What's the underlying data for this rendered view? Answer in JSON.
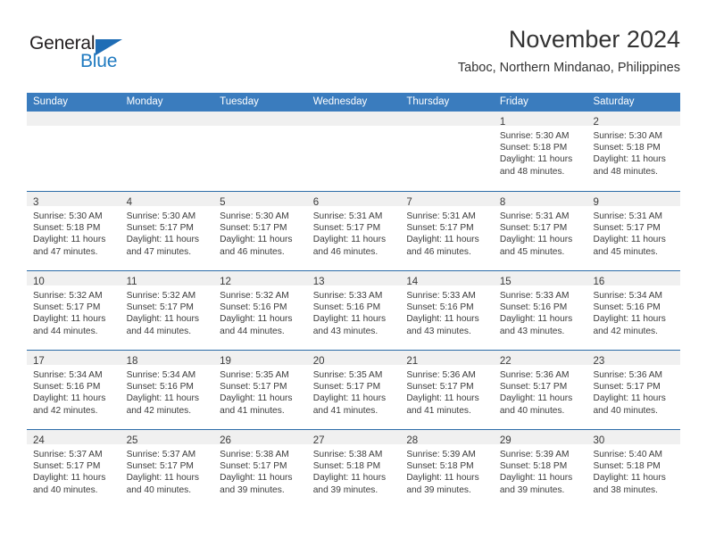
{
  "branding": {
    "logo_text_1": "General",
    "logo_text_2": "Blue"
  },
  "header": {
    "title": "November 2024",
    "subtitle": "Taboc, Northern Mindanao, Philippines"
  },
  "colors": {
    "header_blue": "#3a7cbe",
    "row_divider_blue": "#2c6ca8",
    "day_band_grey": "#f0f0f0",
    "logo_blue": "#1f7ac0",
    "text": "#3b3b3b"
  },
  "weekdays": [
    "Sunday",
    "Monday",
    "Tuesday",
    "Wednesday",
    "Thursday",
    "Friday",
    "Saturday"
  ],
  "weeks": [
    [
      {
        "day": "",
        "lines": []
      },
      {
        "day": "",
        "lines": []
      },
      {
        "day": "",
        "lines": []
      },
      {
        "day": "",
        "lines": []
      },
      {
        "day": "",
        "lines": []
      },
      {
        "day": "1",
        "lines": [
          "Sunrise: 5:30 AM",
          "Sunset: 5:18 PM",
          "Daylight: 11 hours",
          "and 48 minutes."
        ]
      },
      {
        "day": "2",
        "lines": [
          "Sunrise: 5:30 AM",
          "Sunset: 5:18 PM",
          "Daylight: 11 hours",
          "and 48 minutes."
        ]
      }
    ],
    [
      {
        "day": "3",
        "lines": [
          "Sunrise: 5:30 AM",
          "Sunset: 5:18 PM",
          "Daylight: 11 hours",
          "and 47 minutes."
        ]
      },
      {
        "day": "4",
        "lines": [
          "Sunrise: 5:30 AM",
          "Sunset: 5:17 PM",
          "Daylight: 11 hours",
          "and 47 minutes."
        ]
      },
      {
        "day": "5",
        "lines": [
          "Sunrise: 5:30 AM",
          "Sunset: 5:17 PM",
          "Daylight: 11 hours",
          "and 46 minutes."
        ]
      },
      {
        "day": "6",
        "lines": [
          "Sunrise: 5:31 AM",
          "Sunset: 5:17 PM",
          "Daylight: 11 hours",
          "and 46 minutes."
        ]
      },
      {
        "day": "7",
        "lines": [
          "Sunrise: 5:31 AM",
          "Sunset: 5:17 PM",
          "Daylight: 11 hours",
          "and 46 minutes."
        ]
      },
      {
        "day": "8",
        "lines": [
          "Sunrise: 5:31 AM",
          "Sunset: 5:17 PM",
          "Daylight: 11 hours",
          "and 45 minutes."
        ]
      },
      {
        "day": "9",
        "lines": [
          "Sunrise: 5:31 AM",
          "Sunset: 5:17 PM",
          "Daylight: 11 hours",
          "and 45 minutes."
        ]
      }
    ],
    [
      {
        "day": "10",
        "lines": [
          "Sunrise: 5:32 AM",
          "Sunset: 5:17 PM",
          "Daylight: 11 hours",
          "and 44 minutes."
        ]
      },
      {
        "day": "11",
        "lines": [
          "Sunrise: 5:32 AM",
          "Sunset: 5:17 PM",
          "Daylight: 11 hours",
          "and 44 minutes."
        ]
      },
      {
        "day": "12",
        "lines": [
          "Sunrise: 5:32 AM",
          "Sunset: 5:16 PM",
          "Daylight: 11 hours",
          "and 44 minutes."
        ]
      },
      {
        "day": "13",
        "lines": [
          "Sunrise: 5:33 AM",
          "Sunset: 5:16 PM",
          "Daylight: 11 hours",
          "and 43 minutes."
        ]
      },
      {
        "day": "14",
        "lines": [
          "Sunrise: 5:33 AM",
          "Sunset: 5:16 PM",
          "Daylight: 11 hours",
          "and 43 minutes."
        ]
      },
      {
        "day": "15",
        "lines": [
          "Sunrise: 5:33 AM",
          "Sunset: 5:16 PM",
          "Daylight: 11 hours",
          "and 43 minutes."
        ]
      },
      {
        "day": "16",
        "lines": [
          "Sunrise: 5:34 AM",
          "Sunset: 5:16 PM",
          "Daylight: 11 hours",
          "and 42 minutes."
        ]
      }
    ],
    [
      {
        "day": "17",
        "lines": [
          "Sunrise: 5:34 AM",
          "Sunset: 5:16 PM",
          "Daylight: 11 hours",
          "and 42 minutes."
        ]
      },
      {
        "day": "18",
        "lines": [
          "Sunrise: 5:34 AM",
          "Sunset: 5:16 PM",
          "Daylight: 11 hours",
          "and 42 minutes."
        ]
      },
      {
        "day": "19",
        "lines": [
          "Sunrise: 5:35 AM",
          "Sunset: 5:17 PM",
          "Daylight: 11 hours",
          "and 41 minutes."
        ]
      },
      {
        "day": "20",
        "lines": [
          "Sunrise: 5:35 AM",
          "Sunset: 5:17 PM",
          "Daylight: 11 hours",
          "and 41 minutes."
        ]
      },
      {
        "day": "21",
        "lines": [
          "Sunrise: 5:36 AM",
          "Sunset: 5:17 PM",
          "Daylight: 11 hours",
          "and 41 minutes."
        ]
      },
      {
        "day": "22",
        "lines": [
          "Sunrise: 5:36 AM",
          "Sunset: 5:17 PM",
          "Daylight: 11 hours",
          "and 40 minutes."
        ]
      },
      {
        "day": "23",
        "lines": [
          "Sunrise: 5:36 AM",
          "Sunset: 5:17 PM",
          "Daylight: 11 hours",
          "and 40 minutes."
        ]
      }
    ],
    [
      {
        "day": "24",
        "lines": [
          "Sunrise: 5:37 AM",
          "Sunset: 5:17 PM",
          "Daylight: 11 hours",
          "and 40 minutes."
        ]
      },
      {
        "day": "25",
        "lines": [
          "Sunrise: 5:37 AM",
          "Sunset: 5:17 PM",
          "Daylight: 11 hours",
          "and 40 minutes."
        ]
      },
      {
        "day": "26",
        "lines": [
          "Sunrise: 5:38 AM",
          "Sunset: 5:17 PM",
          "Daylight: 11 hours",
          "and 39 minutes."
        ]
      },
      {
        "day": "27",
        "lines": [
          "Sunrise: 5:38 AM",
          "Sunset: 5:18 PM",
          "Daylight: 11 hours",
          "and 39 minutes."
        ]
      },
      {
        "day": "28",
        "lines": [
          "Sunrise: 5:39 AM",
          "Sunset: 5:18 PM",
          "Daylight: 11 hours",
          "and 39 minutes."
        ]
      },
      {
        "day": "29",
        "lines": [
          "Sunrise: 5:39 AM",
          "Sunset: 5:18 PM",
          "Daylight: 11 hours",
          "and 39 minutes."
        ]
      },
      {
        "day": "30",
        "lines": [
          "Sunrise: 5:40 AM",
          "Sunset: 5:18 PM",
          "Daylight: 11 hours",
          "and 38 minutes."
        ]
      }
    ]
  ]
}
